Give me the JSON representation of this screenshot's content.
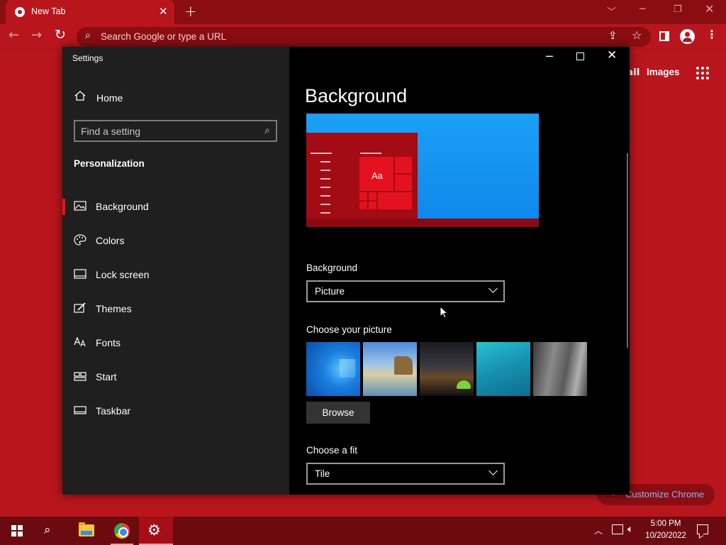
{
  "chrome": {
    "tab_title": "New Tab",
    "omnibox_placeholder": "Search Google or type a URL",
    "gmail_fragment": "ail",
    "images_link": "Images",
    "customize_label": "Customize Chrome"
  },
  "settings": {
    "window_title": "Settings",
    "home_label": "Home",
    "search_placeholder": "Find a setting",
    "section_heading": "Personalization",
    "nav_items": [
      {
        "label": "Background",
        "icon": "picture-icon",
        "active": true
      },
      {
        "label": "Colors",
        "icon": "palette-icon",
        "active": false
      },
      {
        "label": "Lock screen",
        "icon": "lock-screen-icon",
        "active": false
      },
      {
        "label": "Themes",
        "icon": "themes-icon",
        "active": false
      },
      {
        "label": "Fonts",
        "icon": "fonts-icon",
        "active": false
      },
      {
        "label": "Start",
        "icon": "start-icon",
        "active": false
      },
      {
        "label": "Taskbar",
        "icon": "taskbar-icon",
        "active": false
      }
    ],
    "page_title": "Background",
    "preview_tile_text": "Aa",
    "background_label": "Background",
    "background_value": "Picture",
    "choose_picture_label": "Choose your picture",
    "browse_label": "Browse",
    "fit_label": "Choose a fit",
    "fit_value": "Tile"
  },
  "taskbar": {
    "time": "5:00 PM",
    "date": "10/20/2022"
  },
  "colors": {
    "accent": "#e81123",
    "chrome_frame": "#8a0d12",
    "chrome_bg": "#b8161c",
    "taskbar": "#6b0a0f"
  }
}
